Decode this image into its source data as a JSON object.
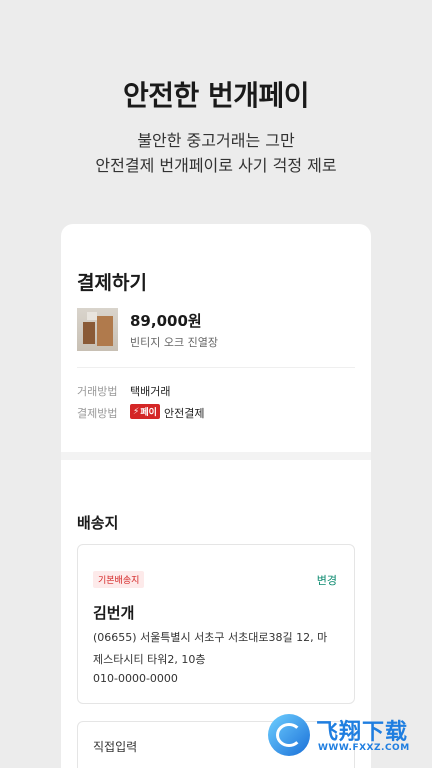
{
  "hero": {
    "title": "안전한 번개페이",
    "subtitle_line1": "불안한 중고거래는 그만",
    "subtitle_line2": "안전결제 번개페이로 사기 걱정 제로"
  },
  "checkout": {
    "title": "결제하기",
    "product": {
      "price": "89,000원",
      "name": "빈티지 오크 진열장"
    },
    "trade_method_label": "거래방법",
    "trade_method_value": "택배거래",
    "payment_method_label": "결제방법",
    "payment_badge": "페이",
    "payment_method_value": "안전결제"
  },
  "shipping": {
    "title": "배송지",
    "default_tag": "기본배송지",
    "change_label": "변경",
    "recipient": "김번개",
    "address_line1": "(06655) 서울특별시 서초구 서초대로38길 12, 마",
    "address_line2": "제스타시티 타워2, 10층",
    "phone": "010-0000-0000",
    "direct_input_label": "직접입력"
  },
  "watermark": {
    "text": "飞翔下载",
    "url": "WWW.FXXZ.COM"
  },
  "colors": {
    "accent_red": "#d42626",
    "link_green": "#0b8a6f",
    "background": "#ececec"
  }
}
